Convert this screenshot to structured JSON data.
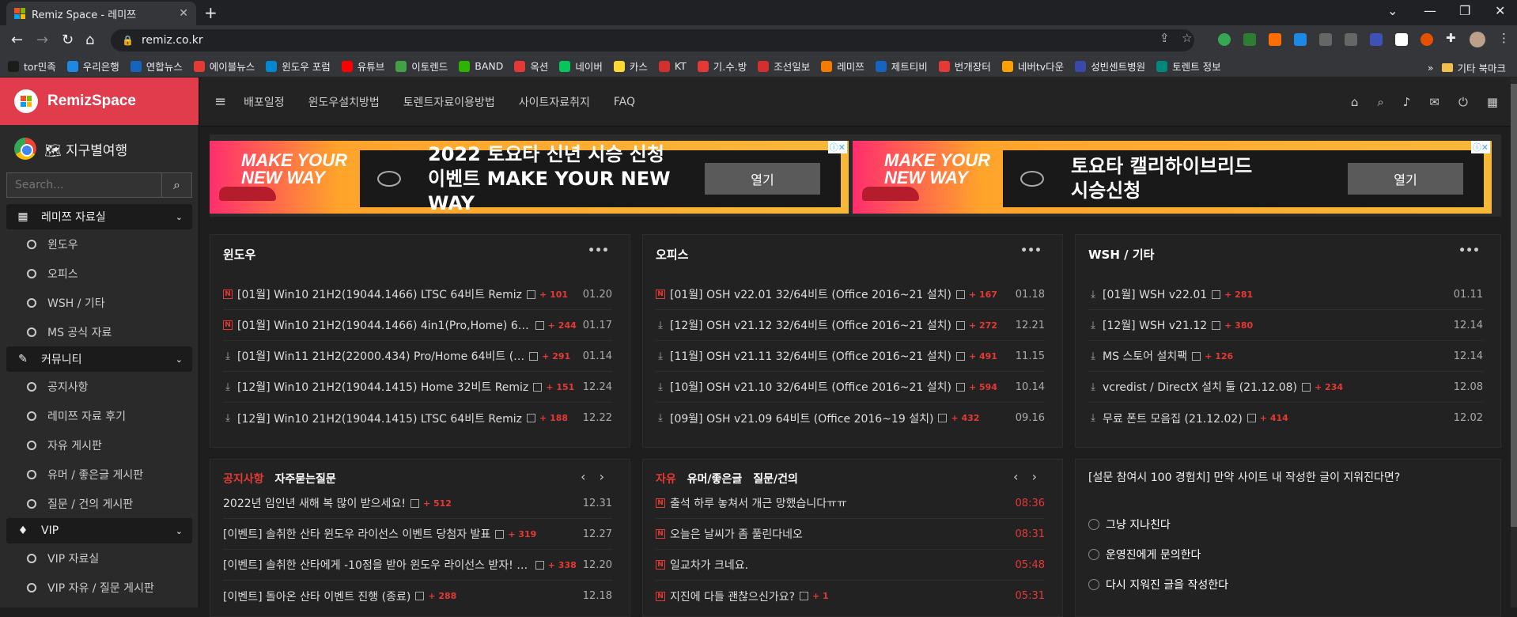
{
  "browser": {
    "tab_title": "Remiz Space - 레미쯔",
    "tab_close": "✕",
    "new_tab": "+",
    "url": "remiz.co.kr",
    "window_controls": [
      "⌄",
      "—",
      "❐",
      "✕"
    ]
  },
  "bookmarks": [
    {
      "label": "tor민족",
      "color": "#1c1c1c"
    },
    {
      "label": "우리은행",
      "color": "#1e88e5"
    },
    {
      "label": "연합뉴스",
      "color": "#1565c0"
    },
    {
      "label": "에이블뉴스",
      "color": "#e53935"
    },
    {
      "label": "윈도우 포럼",
      "color": "#0288d1"
    },
    {
      "label": "유튜브",
      "color": "#ff0000"
    },
    {
      "label": "이토렌드",
      "color": "#43a047"
    },
    {
      "label": "BAND",
      "color": "#2db400"
    },
    {
      "label": "옥션",
      "color": "#e53935"
    },
    {
      "label": "네이버",
      "color": "#03c75a"
    },
    {
      "label": "카스",
      "color": "#fdd835"
    },
    {
      "label": "KT",
      "color": "#d32f2f"
    },
    {
      "label": "기.수.방",
      "color": "#e53935"
    },
    {
      "label": "조선일보",
      "color": "#d32f2f"
    },
    {
      "label": "레미쯔",
      "color": "#f57c00"
    },
    {
      "label": "제트티비",
      "color": "#1565c0"
    },
    {
      "label": "번개장터",
      "color": "#e53935"
    },
    {
      "label": "네버tv다운",
      "color": "#ffa000"
    },
    {
      "label": "성빈센트병원",
      "color": "#3949ab"
    },
    {
      "label": "토렌트 정보",
      "color": "#00897b"
    }
  ],
  "bookmarks_more": "»",
  "bookmarks_other": "기타 북마크",
  "sidebar": {
    "logo": "RemizSpace",
    "chrome_line": "🗺 지구별여행",
    "search_placeholder": "Search...",
    "categories": [
      {
        "label": "레미쯔 자료실",
        "icon": "▦",
        "items": [
          "윈도우",
          "오피스",
          "WSH / 기타",
          "MS 공식 자료"
        ]
      },
      {
        "label": "커뮤니티",
        "icon": "✎",
        "items": [
          "공지사항",
          "레미쯔 자료 후기",
          "자유 게시판",
          "유머 / 좋은글 게시판",
          "질문 / 건의 게시판"
        ]
      },
      {
        "label": "VIP",
        "icon": "♦",
        "items": [
          "VIP 자료실",
          "VIP 자유 / 질문 게시판"
        ]
      }
    ]
  },
  "topnav": {
    "links": [
      "배포일정",
      "윈도우설치방법",
      "토렌트자료이용방법",
      "사이트자료취지",
      "FAQ"
    ]
  },
  "ads": [
    {
      "headline1": "2022 토요타 신년 시승 신청",
      "headline2": "이벤트 MAKE YOUR NEW WAY",
      "button": "열기",
      "banner": "MAKE YOUR NEW WAY"
    },
    {
      "headline1": "토요타 캘리하이브리드",
      "headline2": "시승신청",
      "button": "열기",
      "banner": "MAKE YOUR NEW WAY"
    }
  ],
  "panels": {
    "windows": {
      "title": "윈도우",
      "dots": "•••",
      "rows": [
        {
          "icon": "new",
          "text": "[01월] Win10 21H2(19044.1466) LTSC 64비트 Remiz",
          "count": "+ 101",
          "date": "01.20"
        },
        {
          "icon": "new",
          "text": "[01월] Win10 21H2(19044.1466) 4in1(Pro,Home) 64…",
          "count": "+ 244",
          "date": "01.17"
        },
        {
          "icon": "dl",
          "text": "[01월] Win11 21H2(22000.434) Pro/Home 64비트 (…",
          "count": "+ 291",
          "date": "01.14"
        },
        {
          "icon": "dl",
          "text": "[12월] Win10 21H2(19044.1415) Home 32비트 Remiz",
          "count": "+ 151",
          "date": "12.24"
        },
        {
          "icon": "dl",
          "text": "[12월] Win10 21H2(19044.1415) LTSC 64비트 Remiz",
          "count": "+ 188",
          "date": "12.22"
        }
      ]
    },
    "office": {
      "title": "오피스",
      "dots": "•••",
      "rows": [
        {
          "icon": "new",
          "text": "[01월] OSH v22.01 32/64비트 (Office 2016~21 설치)",
          "count": "+ 167",
          "date": "01.18"
        },
        {
          "icon": "dl",
          "text": "[12월] OSH v21.12 32/64비트 (Office 2016~21 설치)",
          "count": "+ 272",
          "date": "12.21"
        },
        {
          "icon": "dl",
          "text": "[11월] OSH v21.11 32/64비트 (Office 2016~21 설치)",
          "count": "+ 491",
          "date": "11.15"
        },
        {
          "icon": "dl",
          "text": "[10월] OSH v21.10 32/64비트 (Office 2016~21 설치)",
          "count": "+ 594",
          "date": "10.14"
        },
        {
          "icon": "dl",
          "text": "[09월] OSH v21.09 64비트 (Office 2016~19 설치)",
          "count": "+ 432",
          "date": "09.16"
        }
      ]
    },
    "wsh": {
      "title": "WSH / 기타",
      "dots": "•••",
      "rows": [
        {
          "icon": "dl",
          "text": "[01월] WSH v22.01",
          "count": "+ 281",
          "date": "01.11"
        },
        {
          "icon": "dl",
          "text": "[12월] WSH v21.12",
          "count": "+ 380",
          "date": "12.14"
        },
        {
          "icon": "dl",
          "text": "MS 스토어 설치팩",
          "count": "+ 126",
          "date": "12.14"
        },
        {
          "icon": "dl",
          "text": "vcredist / DirectX 설치 툴 (21.12.08)",
          "count": "+ 234",
          "date": "12.08"
        },
        {
          "icon": "dl",
          "text": "무료 폰트 모음집 (21.12.02)",
          "count": "+ 414",
          "date": "12.02"
        }
      ]
    },
    "notice": {
      "tabs": [
        "공지사항",
        "자주묻는질문"
      ],
      "arrows": "‹ ›",
      "rows": [
        {
          "text": "2022년 임인년 새해 복 많이 받으세요!",
          "count": "+ 512",
          "date": "12.31"
        },
        {
          "text": "[이벤트] 솔취한 산타 윈도우 라이선스 이벤트 당첨자 발표",
          "count": "+ 319",
          "date": "12.27"
        },
        {
          "text": "[이벤트] 솔취한 산타에게 -10점을 받아 윈도우 라이선스 받자! (종…",
          "count": "+ 338",
          "date": "12.20"
        },
        {
          "text": "[이벤트] 돌아온 산타 이벤트 진행 (종료)",
          "count": "+ 288",
          "date": "12.18"
        }
      ]
    },
    "free": {
      "tabs": [
        "자유",
        "유머/좋은글",
        "질문/건의"
      ],
      "arrows": "‹ ›",
      "rows": [
        {
          "text": "출석 하루 놓쳐서 개근 망했습니다ㅠㅠ",
          "count": "",
          "date": "08:36"
        },
        {
          "text": "오늘은 날씨가 좀 풀린다네오",
          "count": "",
          "date": "08:31"
        },
        {
          "text": "일교차가 크네요.",
          "count": "",
          "date": "05:48"
        },
        {
          "text": "지진에 다들 괜찮으신가요?",
          "count": "+ 1",
          "date": "05:31"
        }
      ]
    },
    "poll": {
      "question": "[설문 참여시 100 경험치] 만약 사이트 내 작성한 글이 지워진다면?",
      "options": [
        "그냥 지나친다",
        "운영진에게 문의한다",
        "다시 지워진 글을 작성한다"
      ]
    }
  }
}
